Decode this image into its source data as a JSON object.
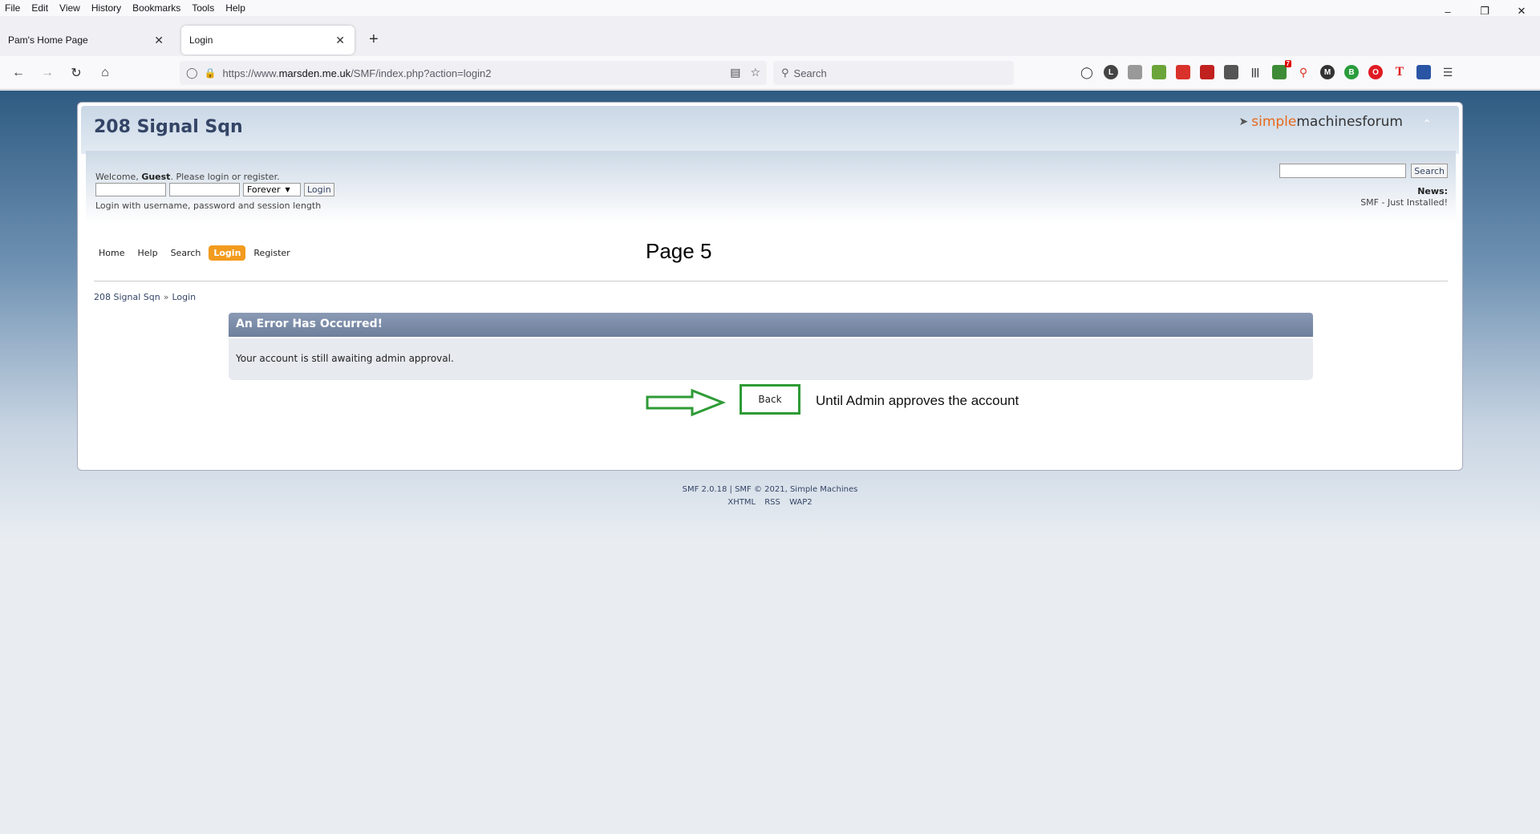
{
  "menubar": {
    "items": [
      "File",
      "Edit",
      "View",
      "History",
      "Bookmarks",
      "Tools",
      "Help"
    ]
  },
  "tabs": [
    {
      "label": "Pam's Home Page"
    },
    {
      "label": "Login"
    }
  ],
  "navbar": {
    "url_prefix": "https://www.",
    "url_host": "marsden.me.uk",
    "url_path": "/SMF/index.php?action=login2",
    "search_placeholder": "Search",
    "ext_badge": "7"
  },
  "forum": {
    "title": "208 Signal Sqn",
    "logo_simple": "simple",
    "logo_machines": "machines",
    "logo_forum": " forum"
  },
  "user": {
    "welcome_prefix": "Welcome, ",
    "guest": "Guest",
    "welcome_suffix": ". Please login or register.",
    "session_select": "Forever",
    "login_button": "Login",
    "hint": "Login with username, password and session length"
  },
  "search": {
    "button": "Search"
  },
  "news": {
    "label": "News:",
    "text": "SMF - Just Installed!"
  },
  "mainmenu": {
    "items": [
      "Home",
      "Help",
      "Search",
      "Login",
      "Register"
    ],
    "active": "Login"
  },
  "page_label": "Page 5",
  "breadcrumb": {
    "items": [
      "208 Signal Sqn",
      "Login"
    ],
    "separator": "»"
  },
  "error": {
    "title": "An Error Has Occurred!",
    "message": "Your account is still awaiting admin approval."
  },
  "back_button": "Back",
  "annotation": "Until Admin approves the account",
  "footer": {
    "line1": "SMF 2.0.18 | SMF © 2021, Simple Machines",
    "links": [
      "XHTML",
      "RSS",
      "WAP2"
    ]
  },
  "colors": {
    "accent_active": "#f29b1e",
    "annotation_green": "#2e9b36",
    "title": "#334466"
  }
}
